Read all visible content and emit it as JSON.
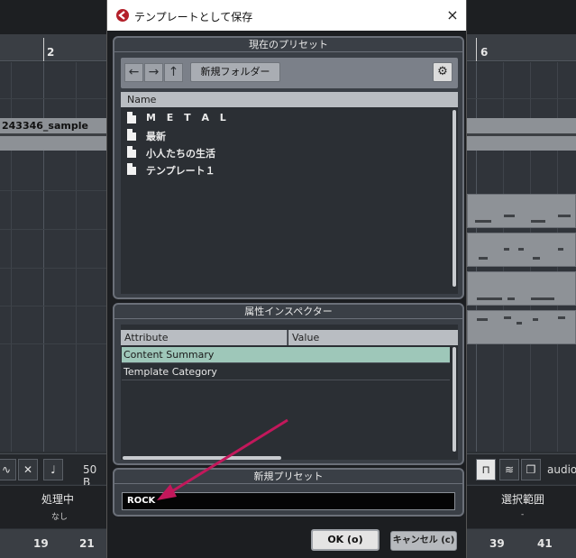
{
  "daw": {
    "ruler_left_bar": "2",
    "ruler_right_bar": "6",
    "clip_name": "243346_sample",
    "toolbar_value": "50 B",
    "toolbar_right_text": "audio",
    "status_left_title": "処理中",
    "status_left_sub": "なし",
    "status_right_title": "選択範囲",
    "status_right_sub": "-",
    "bottom_left_numbers": [
      "19",
      "21"
    ],
    "bottom_right_numbers": [
      "39",
      "41"
    ]
  },
  "dialog": {
    "title": "テンプレートとして保存",
    "close_icon": "×",
    "presets": {
      "header": "現在のプリセット",
      "new_folder_label": "新規フォルダー",
      "column_name": "Name",
      "items": [
        "M E T A L",
        "最新",
        "小人たちの生活",
        "テンプレート１"
      ]
    },
    "inspector": {
      "header": "属性インスペクター",
      "col_attribute": "Attribute",
      "col_value": "Value",
      "rows": [
        "Content Summary",
        "Template Category"
      ]
    },
    "new_preset": {
      "header": "新規プリセット",
      "value": "ROCK"
    },
    "ok_label": "OK (o)",
    "cancel_label": "キャンセル (c)"
  },
  "colors": {
    "selected_row": "#9ec7b9",
    "annotation_arrow": "#c2185b"
  }
}
